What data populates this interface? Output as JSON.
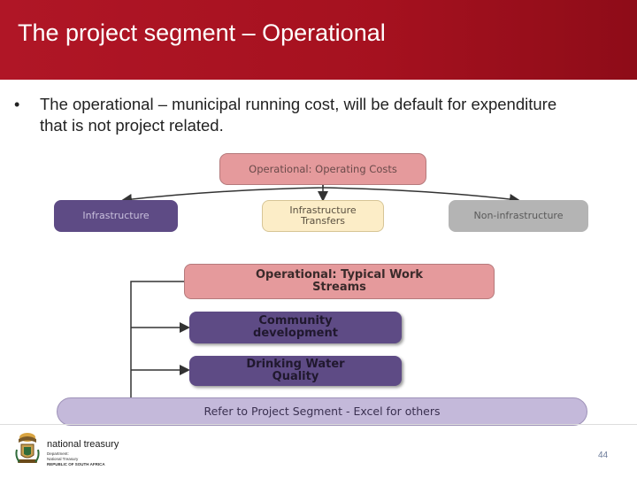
{
  "header": {
    "title": "The project segment – Operational"
  },
  "bullet": {
    "marker": "•",
    "line1": "The operational – municipal running cost, will be default for expenditure",
    "line2": "that is not project related."
  },
  "diagram": {
    "operating_costs": "Operational: Operating Costs",
    "infrastructure": "Infrastructure",
    "infrastructure_transfers_1": "Infrastructure",
    "infrastructure_transfers_2": "Transfers",
    "non_infrastructure": "Non-infrastructure",
    "typical_1": "Operational: Typical Work",
    "typical_2": "Streams",
    "community_1": "Community",
    "community_2": "development",
    "drinking_1": "Drinking Water",
    "drinking_2": "Quality",
    "refer": "Refer to Project Segment - Excel for others"
  },
  "footer": {
    "logo_title": "national treasury",
    "logo_line1": "Department:",
    "logo_line2": "National Treasury",
    "logo_line3": "REPUBLIC OF SOUTH AFRICA",
    "page_number": "44"
  },
  "colors": {
    "header_red": "#a5111f",
    "pink_box": "#e59a9c",
    "purple_box": "#5e4b85",
    "cream_box": "#fcedc7",
    "grey_box": "#b4b4b4",
    "lavender_box": "#c4b9da"
  }
}
